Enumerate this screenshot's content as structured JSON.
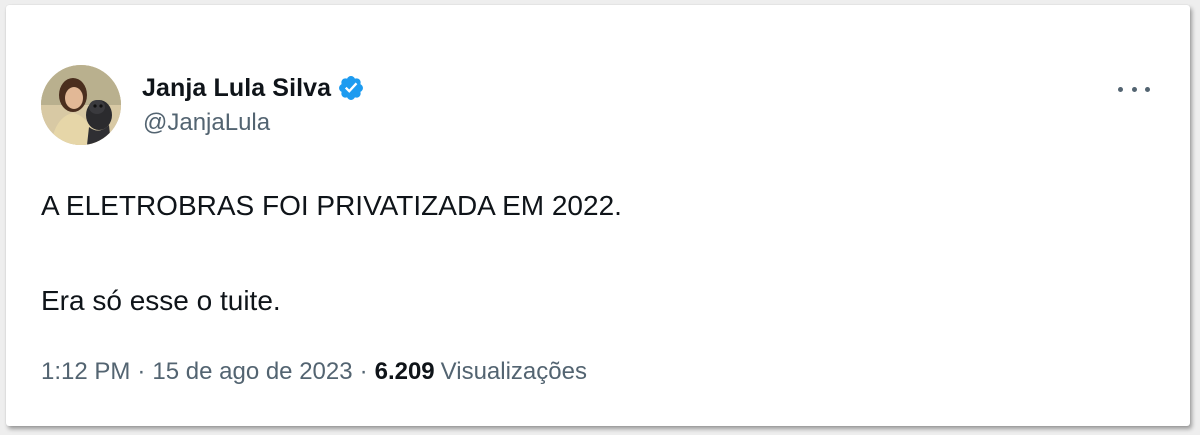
{
  "tweet": {
    "author": {
      "display_name": "Janja Lula Silva",
      "handle": "@JanjaLula",
      "verified_icon": "verified-badge-icon",
      "verified_color": "#1d9bf0"
    },
    "more_icon": "more-horizontal-icon",
    "text_lines": [
      "A ELETROBRAS FOI PRIVATIZADA EM 2022.",
      "Era só esse o tuite."
    ],
    "time": "1:12 PM",
    "separator": "·",
    "date": "15 de ago de 2023",
    "views_count": "6.209",
    "views_label": "Visualizações"
  }
}
